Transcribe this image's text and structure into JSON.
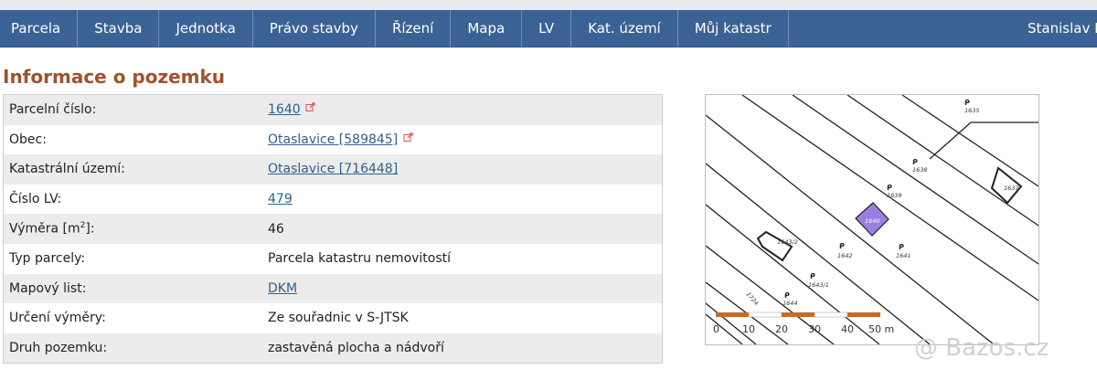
{
  "nav": {
    "items": [
      "Parcela",
      "Stavba",
      "Jednotka",
      "Právo stavby",
      "Řízení",
      "Mapa",
      "LV",
      "Kat. území",
      "Můj katastr"
    ],
    "user": "Stanislav Fo"
  },
  "page": {
    "title": "Informace o pozemku"
  },
  "info": {
    "rows": [
      {
        "label": "Parcelní číslo:",
        "value": "1640"
      },
      {
        "label": "Obec:",
        "value": "Otaslavice [589845]"
      },
      {
        "label": "Katastrální území:",
        "value": "Otaslavice [716448]"
      },
      {
        "label": "Číslo LV:",
        "value": "479"
      },
      {
        "label": "Výměra [m",
        "value": "46"
      },
      {
        "label": "Typ parcely:",
        "value": "Parcela katastru nemovitostí"
      },
      {
        "label": "Mapový list:",
        "value": "DKM"
      },
      {
        "label": "Určení výměry:",
        "value": "Ze souřadnic v S-JTSK"
      },
      {
        "label": "Druh pozemku:",
        "value": "zastavěná plocha a nádvoří"
      }
    ],
    "area_sup": "2",
    "area_suffix": "]:"
  },
  "map": {
    "parcel_labels": [
      "1635",
      "1638",
      "1637",
      "1639",
      "1640",
      "1643/2",
      "1642",
      "1641",
      "1643/1",
      "1644",
      "1724"
    ],
    "scale_labels": [
      "0",
      "10",
      "20",
      "30",
      "40",
      "50 m"
    ],
    "highlight_color": "#9b7fe0"
  },
  "watermark": "@ Bazos.cz"
}
